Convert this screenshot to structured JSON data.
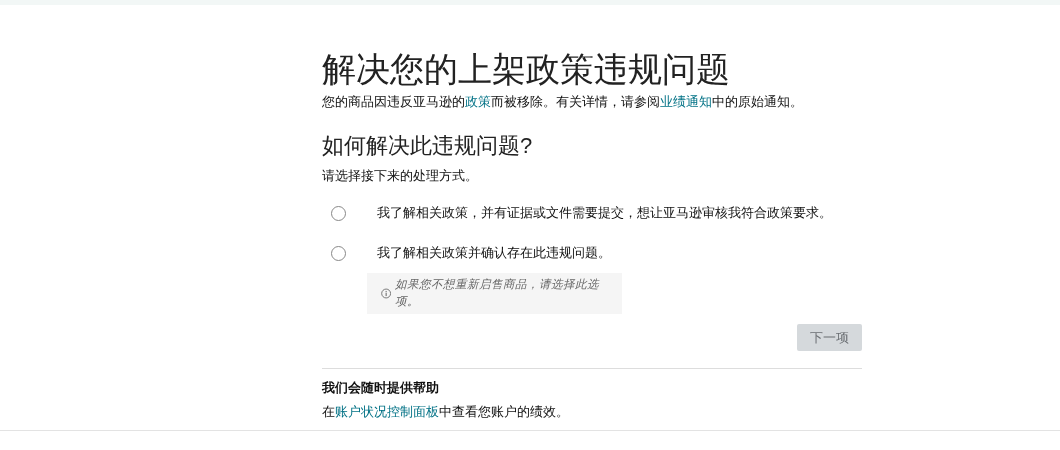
{
  "title": "解决您的上架政策违规问题",
  "intro": [
    {
      "kind": "text",
      "text": "您的商品因违反亚马逊的"
    },
    {
      "kind": "link",
      "text": "政策"
    },
    {
      "kind": "text",
      "text": "而被移除。有关详情，请参阅"
    },
    {
      "kind": "link",
      "text": "业绩通知"
    },
    {
      "kind": "text",
      "text": "中的原始通知。"
    }
  ],
  "question": "如何解决此违规问题?",
  "instruction": "请选择接下来的处理方式。",
  "options": [
    {
      "label": "我了解相关政策，并有证据或文件需要提交，想让亚马逊审核我符合政策要求。",
      "selected": false
    },
    {
      "label": "我了解相关政策并确认存在此违规问题。",
      "selected": false,
      "hint": "如果您不想重新启售商品，请选择此选项。"
    }
  ],
  "next_button": {
    "label": "下一项",
    "disabled": true
  },
  "help": {
    "heading": "我们会随时提供帮助",
    "text": [
      {
        "kind": "text",
        "text": "在"
      },
      {
        "kind": "link",
        "text": "账户状况控制面板"
      },
      {
        "kind": "text",
        "text": "中查看您账户的绩效。"
      }
    ]
  }
}
